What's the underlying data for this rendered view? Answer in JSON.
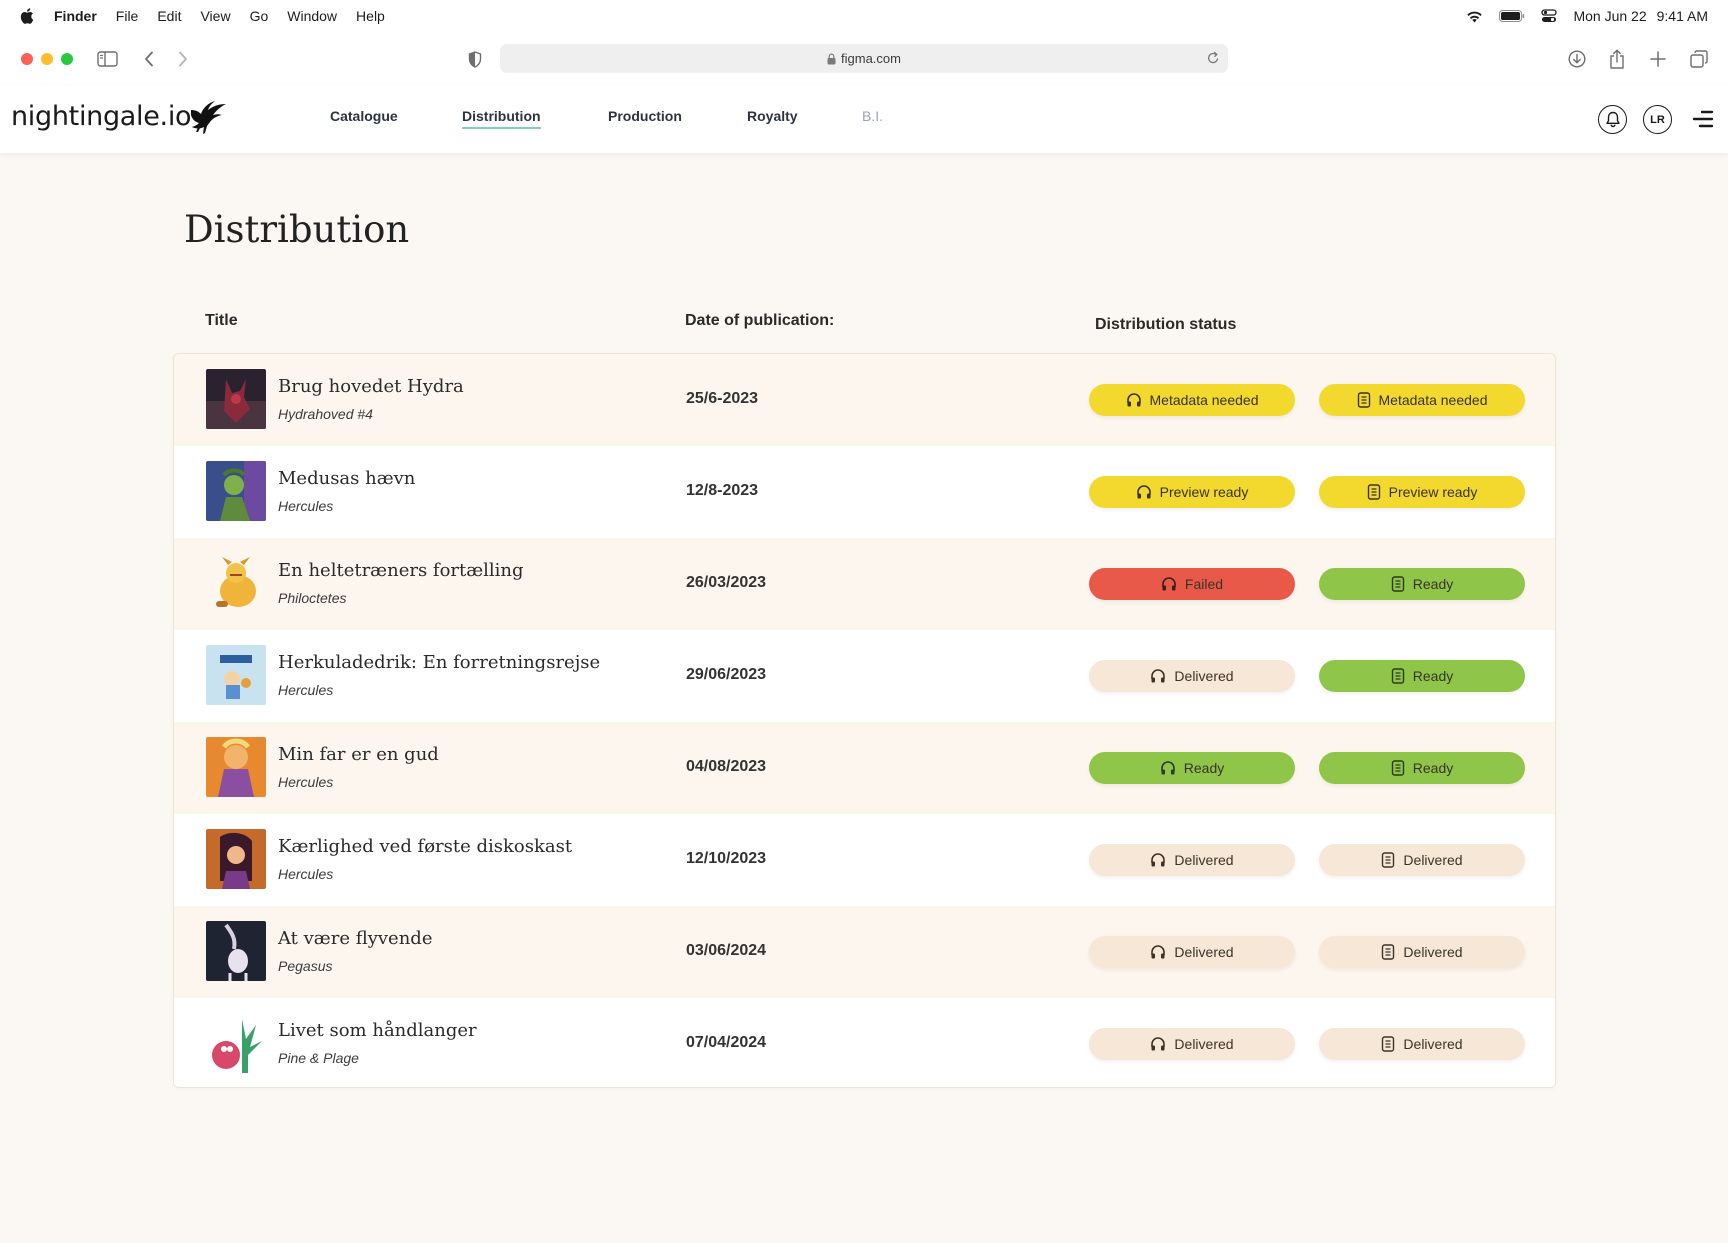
{
  "menubar": {
    "app_name": "Finder",
    "menus": [
      "File",
      "Edit",
      "View",
      "Go",
      "Window",
      "Help"
    ],
    "date": "Mon Jun 22",
    "time": "9:41 AM"
  },
  "browser": {
    "url": "figma.com"
  },
  "header": {
    "logo_text": "nightingale.io",
    "nav": [
      {
        "label": "Catalogue",
        "state": "normal"
      },
      {
        "label": "Distribution",
        "state": "active"
      },
      {
        "label": "Production",
        "state": "normal"
      },
      {
        "label": "Royalty",
        "state": "normal"
      },
      {
        "label": "B.I.",
        "state": "disabled"
      }
    ],
    "user_initials": "LR"
  },
  "page": {
    "title": "Distribution",
    "columns": {
      "title": "Title",
      "date": "Date of publication:",
      "status": "Distribution status"
    }
  },
  "colors": {
    "yellow": "#f3d82e",
    "red": "#e9594a",
    "green": "#8fc548",
    "cream": "#f7e7d6",
    "active_underline": "#7fd0c0"
  },
  "rows": [
    {
      "title": "Brug hovedet Hydra",
      "series": "Hydrahoved #4",
      "date": "25/6-2023",
      "audio": {
        "label": "Metadata needed",
        "color": "yellow",
        "icon": "headphones-icon"
      },
      "ebook": {
        "label": "Metadata needed",
        "color": "yellow",
        "icon": "document-icon"
      }
    },
    {
      "title": "Medusas hævn",
      "series": "Hercules",
      "date": "12/8-2023",
      "audio": {
        "label": "Preview ready",
        "color": "yellow",
        "icon": "headphones-icon"
      },
      "ebook": {
        "label": "Preview ready",
        "color": "yellow",
        "icon": "document-icon"
      }
    },
    {
      "title": "En heltetræners fortælling",
      "series": "Philoctetes",
      "date": "26/03/2023",
      "audio": {
        "label": "Failed",
        "color": "red",
        "icon": "headphones-icon"
      },
      "ebook": {
        "label": "Ready",
        "color": "green",
        "icon": "document-icon"
      }
    },
    {
      "title": "Herkuladedrik: En forretningsrejse",
      "series": "Hercules",
      "date": "29/06/2023",
      "audio": {
        "label": "Delivered",
        "color": "cream",
        "icon": "headphones-icon"
      },
      "ebook": {
        "label": "Ready",
        "color": "green",
        "icon": "document-icon"
      }
    },
    {
      "title": "Min far er en gud",
      "series": "Hercules",
      "date": "04/08/2023",
      "audio": {
        "label": "Ready",
        "color": "green",
        "icon": "headphones-icon"
      },
      "ebook": {
        "label": "Ready",
        "color": "green",
        "icon": "document-icon"
      }
    },
    {
      "title": "Kærlighed ved første diskoskast",
      "series": "Hercules",
      "date": "12/10/2023",
      "audio": {
        "label": "Delivered",
        "color": "cream",
        "icon": "headphones-icon"
      },
      "ebook": {
        "label": "Delivered",
        "color": "cream",
        "icon": "document-icon"
      }
    },
    {
      "title": "At være flyvende",
      "series": "Pegasus",
      "date": "03/06/2024",
      "audio": {
        "label": "Delivered",
        "color": "cream",
        "icon": "headphones-icon"
      },
      "ebook": {
        "label": "Delivered",
        "color": "cream",
        "icon": "document-icon"
      }
    },
    {
      "title": "Livet som håndlanger",
      "series": "Pine & Plage",
      "date": "07/04/2024",
      "audio": {
        "label": "Delivered",
        "color": "cream",
        "icon": "headphones-icon"
      },
      "ebook": {
        "label": "Delivered",
        "color": "cream",
        "icon": "document-icon"
      }
    }
  ]
}
